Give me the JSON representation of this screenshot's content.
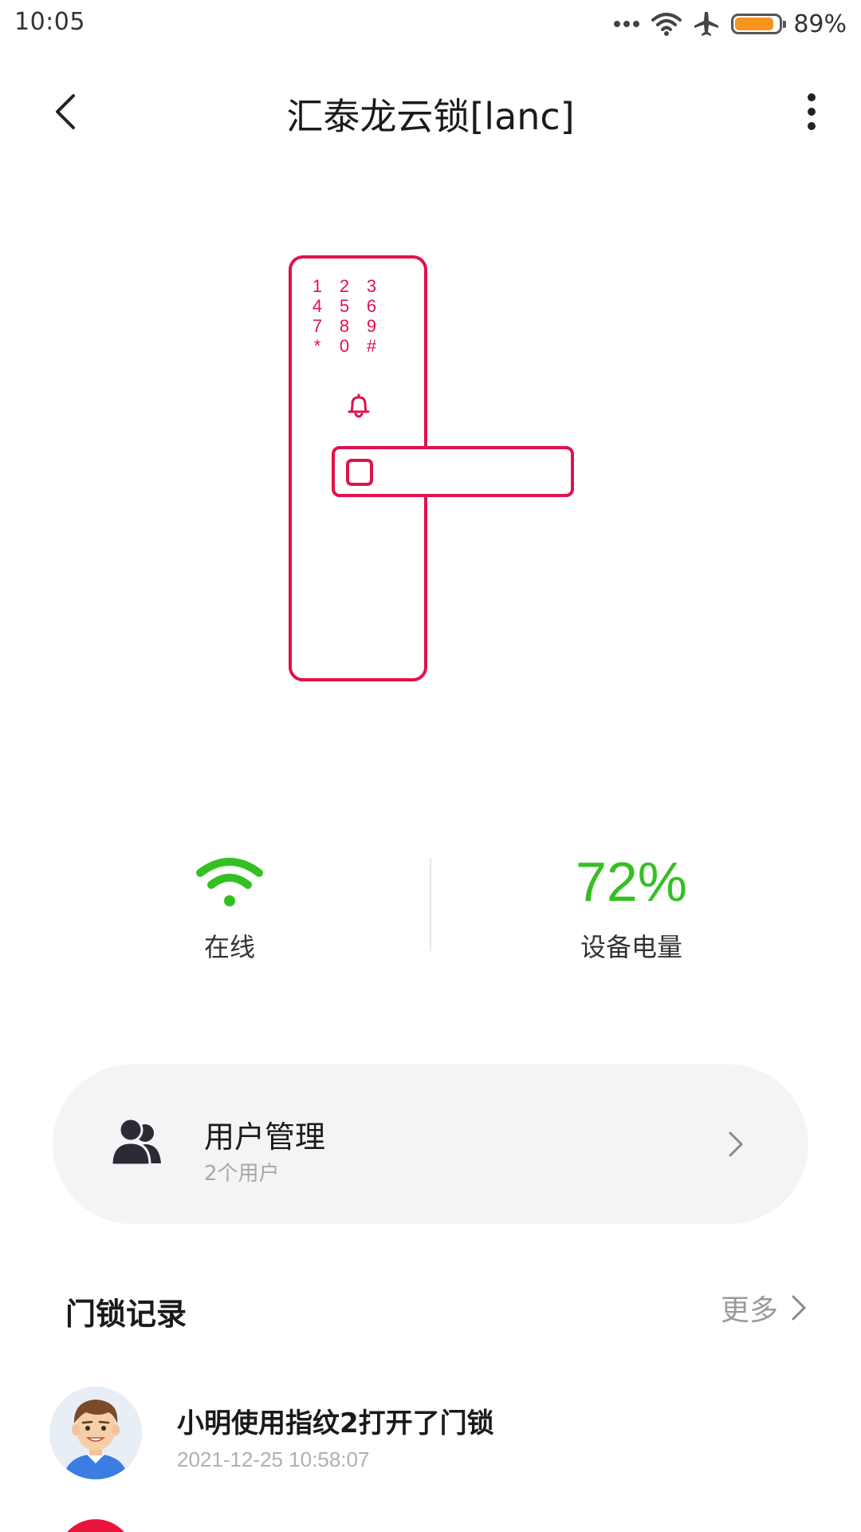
{
  "status_bar": {
    "time": "10:05",
    "battery_pct": "89%",
    "battery_level": 0.89,
    "battery_color": "#f7941d",
    "icons": [
      "dots-icon",
      "wifi-icon",
      "airplane-icon",
      "battery-icon"
    ]
  },
  "header": {
    "title": "汇泰龙云锁[lanc]",
    "back_icon": "chevron-left-icon",
    "more_icon": "more-vertical-icon"
  },
  "lock": {
    "accent_color": "#e0124a",
    "keypad": [
      [
        "1",
        "2",
        "3"
      ],
      [
        "4",
        "5",
        "6"
      ],
      [
        "7",
        "8",
        "9"
      ],
      [
        "*",
        "0",
        "#"
      ]
    ],
    "bell_icon": "bell-icon",
    "fingerprint_icon": "fingerprint-square-icon"
  },
  "status": {
    "online_label": "在线",
    "online_icon": "wifi-icon",
    "online_color": "#34c023",
    "battery_value": "72%",
    "battery_label": "设备电量",
    "battery_color": "#34c023"
  },
  "user_management": {
    "title": "用户管理",
    "subtitle": "2个用户",
    "icon": "users-icon"
  },
  "records": {
    "title": "门锁记录",
    "more_label": "更多",
    "items": [
      {
        "text": "小明使用指纹2打开了门锁",
        "time": "2021-12-25 10:58:07",
        "avatar": "man-avatar-icon"
      }
    ]
  }
}
